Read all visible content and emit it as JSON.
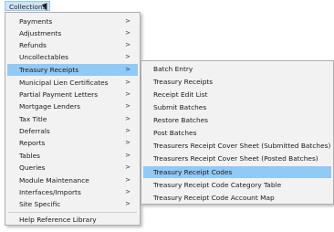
{
  "menubar": {
    "collections_label": "Collections"
  },
  "main_menu": {
    "items": [
      {
        "label": "Payments",
        "arrow": ">"
      },
      {
        "label": "Adjustments",
        "arrow": ">"
      },
      {
        "label": "Refunds",
        "arrow": ">"
      },
      {
        "label": "Uncollectables",
        "arrow": ">"
      },
      {
        "label": "Treasury Receipts",
        "arrow": ">"
      },
      {
        "label": "Municipal Lien Certificates",
        "arrow": ">"
      },
      {
        "label": "Partial Payment Letters",
        "arrow": ">"
      },
      {
        "label": "Mortgage Lenders",
        "arrow": ">"
      },
      {
        "label": "Tax Title",
        "arrow": ">"
      },
      {
        "label": "Deferrals",
        "arrow": ">"
      },
      {
        "label": "Reports",
        "arrow": ">"
      },
      {
        "label": "Tables",
        "arrow": ">"
      },
      {
        "label": "Queries",
        "arrow": ">"
      },
      {
        "label": "Module Maintenance",
        "arrow": ">"
      },
      {
        "label": "Interfaces/Imports",
        "arrow": ">"
      },
      {
        "label": "Site Specific",
        "arrow": ">"
      }
    ],
    "footer_item": "Help Reference Library"
  },
  "sub_menu": {
    "items": [
      "Batch Entry",
      "Treasury Receipts",
      "Receipt Edit List",
      "Submit Batches",
      "Restore Batches",
      "Post Batches",
      "Treasurers Receipt Cover Sheet (Submitted Batches)",
      "Treasurers Receipt Cover Sheet (Posted Batches)",
      "Treasury Receipt Codes",
      "Treasury Receipt Code Category Table",
      "Treasury Receipt Code Account Map"
    ]
  },
  "colors": {
    "highlight": "#91c9f7",
    "menu_bg": "#f2f2f2",
    "menubar_active": "#cce4f7"
  },
  "icons": {
    "submenu_arrow": "chevron-right-icon",
    "pointer": "mouse-cursor-icon"
  }
}
